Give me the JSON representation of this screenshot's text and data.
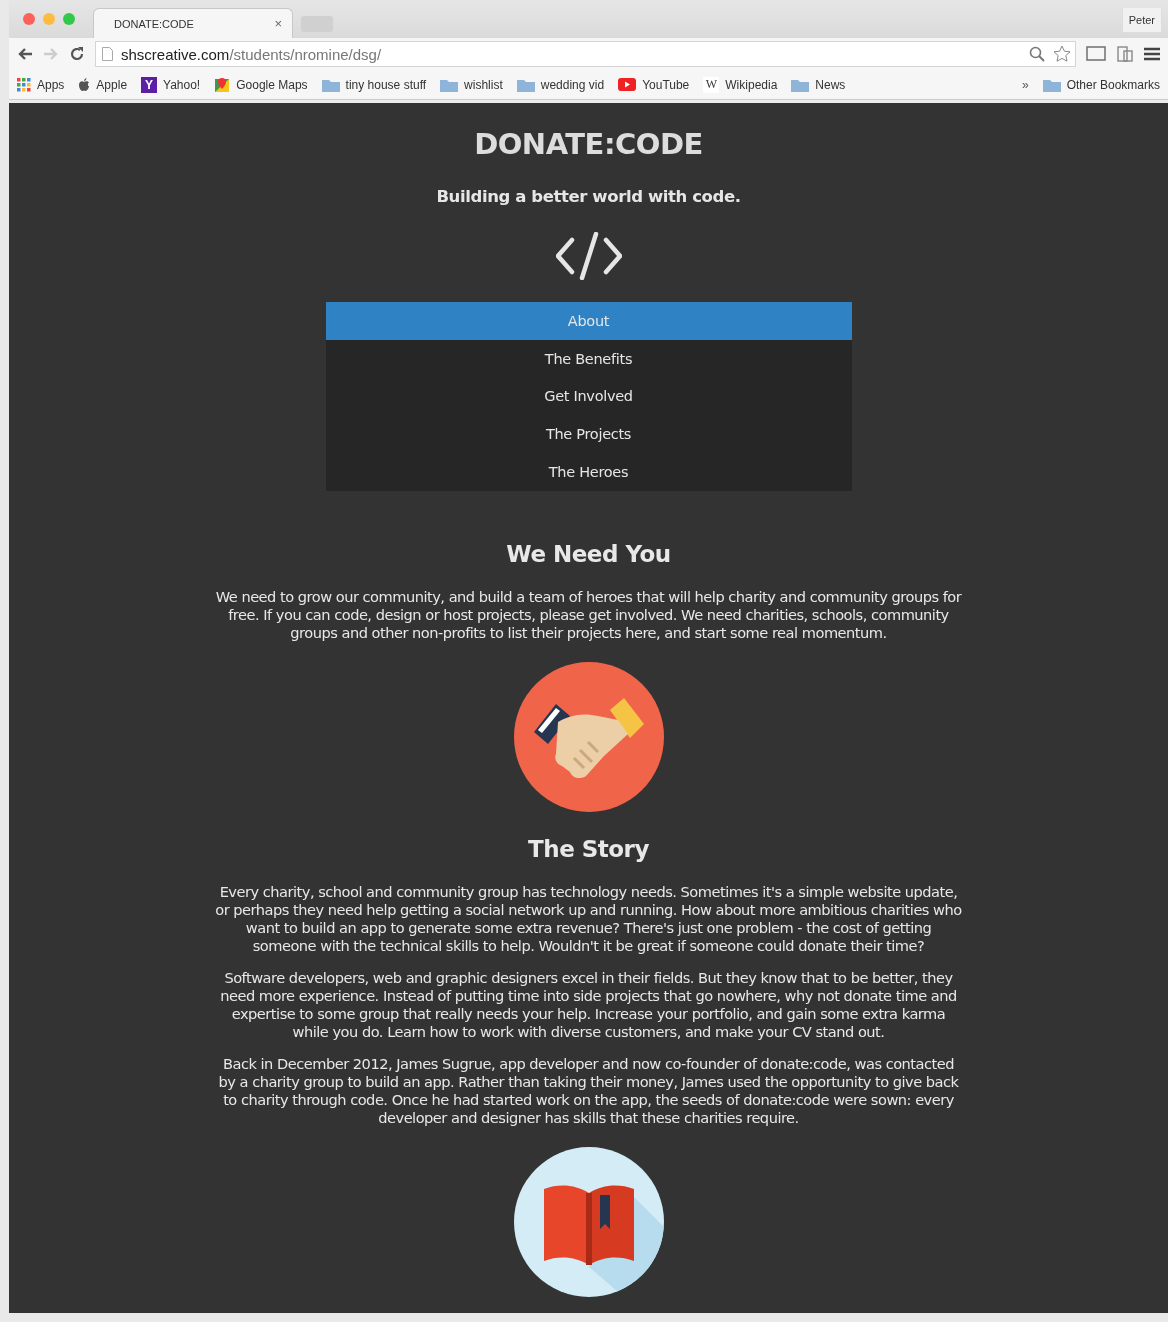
{
  "browser": {
    "tab_title": "DONATE:CODE",
    "tab_close": "×",
    "profile": "Peter",
    "url_host": "shscreative.com",
    "url_path": "/students/nromine/dsg/",
    "bookmarks": [
      {
        "label": "Apps",
        "kind": "apps"
      },
      {
        "label": "Apple",
        "kind": "apple"
      },
      {
        "label": "Yahoo!",
        "kind": "yahoo",
        "icon_letter": "Y"
      },
      {
        "label": "Google Maps",
        "kind": "maps"
      },
      {
        "label": "tiny house stuff",
        "kind": "folder"
      },
      {
        "label": "wishlist",
        "kind": "folder"
      },
      {
        "label": "wedding vid",
        "kind": "folder"
      },
      {
        "label": "YouTube",
        "kind": "youtube"
      },
      {
        "label": "Wikipedia",
        "kind": "wiki",
        "icon_letter": "W"
      },
      {
        "label": "News",
        "kind": "folder"
      }
    ],
    "overflow": "»",
    "other_bookmarks": "Other Bookmarks"
  },
  "site": {
    "title": "DONATE:CODE",
    "tagline": "Building a better world with code.",
    "nav": [
      {
        "label": "About",
        "selected": true
      },
      {
        "label": "The Benefits",
        "selected": false
      },
      {
        "label": "Get Involved",
        "selected": false
      },
      {
        "label": "The Projects",
        "selected": false
      },
      {
        "label": "The Heroes",
        "selected": false
      }
    ],
    "sections": [
      {
        "heading": "We Need You",
        "kind": "handshake",
        "paragraphs": [
          "We need to grow our community, and build a team of heroes that will help charity and community groups for free. If you can code, design or host projects, please get involved. We need charities, schools, community groups and other non-profits to list their projects here, and start some real momentum."
        ]
      },
      {
        "heading": "The Story",
        "kind": "book",
        "paragraphs": [
          "Every charity, school and community group has technology needs. Sometimes it's a simple website update, or perhaps they need help getting a social network up and running. How about more ambitious charities who want to build an app to generate some extra revenue? There's just one problem - the cost of getting someone with the technical skills to help. Wouldn't it be great if someone could donate their time?",
          "Software developers, web and graphic designers excel in their fields. But they know that to be better, they need more experience. Instead of putting time into side projects that go nowhere, why not donate time and expertise to some group that really needs your help. Increase your portfolio, and gain some extra karma while you do. Learn how to work with diverse customers, and make your CV stand out.",
          "Back in December 2012, James Sugrue, app developer and now co-founder of donate:code, was contacted by a charity group to build an app. Rather than taking their money, James used the opportunity to give back to charity through code. Once he had started work on the app, the seeds of donate:code were sown: every developer and designer has skills that these charities require."
        ]
      }
    ]
  }
}
